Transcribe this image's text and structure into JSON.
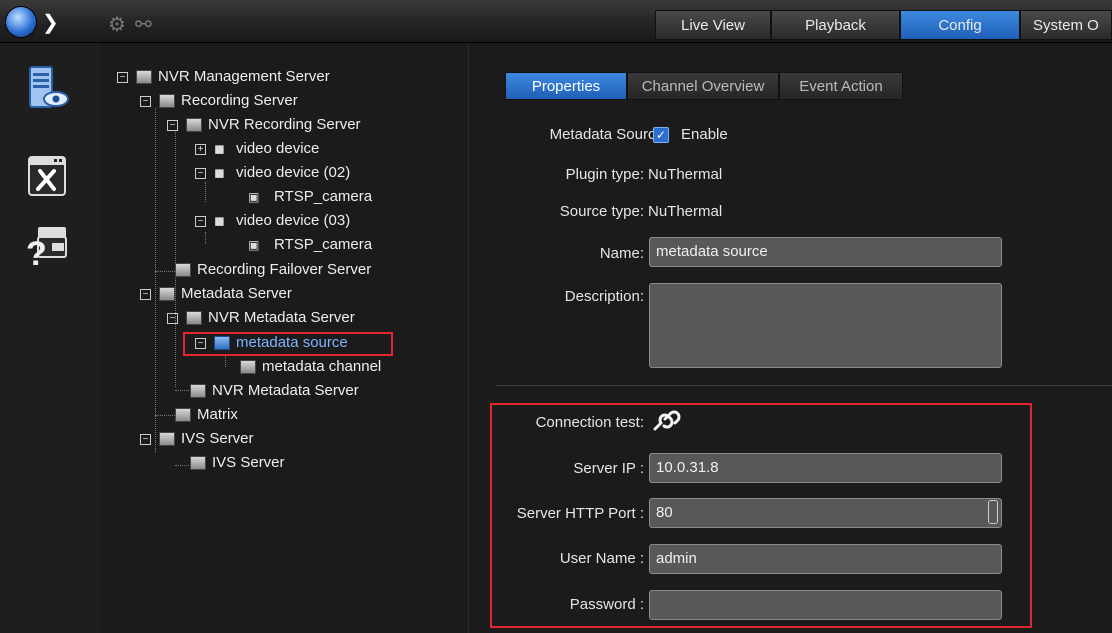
{
  "topbar": {
    "nav_tabs": [
      {
        "label": "Live View",
        "active": false
      },
      {
        "label": "Playback",
        "active": false
      },
      {
        "label": "Config",
        "active": true
      },
      {
        "label": "System O",
        "active": false
      }
    ]
  },
  "tree": {
    "items": [
      {
        "label": "NVR Management Server",
        "icon": "management-server-icon"
      },
      {
        "label": "Recording Server",
        "icon": "recording-server-icon"
      },
      {
        "label": "NVR Recording Server",
        "icon": "recording-server-icon"
      },
      {
        "label": "video device",
        "icon": "camera-icon"
      },
      {
        "label": "video device (02)",
        "icon": "camera-icon"
      },
      {
        "label": "RTSP_camera",
        "icon": "rtsp-camera-icon"
      },
      {
        "label": "video device (03)",
        "icon": "camera-icon"
      },
      {
        "label": "RTSP_camera",
        "icon": "rtsp-camera-icon"
      },
      {
        "label": "Recording Failover Server",
        "icon": "failover-server-icon"
      },
      {
        "label": "Metadata Server",
        "icon": "metadata-server-icon"
      },
      {
        "label": "NVR Metadata Server",
        "icon": "metadata-server-icon"
      },
      {
        "label": "metadata source",
        "icon": "metadata-source-icon",
        "selected": true
      },
      {
        "label": "metadata channel",
        "icon": "metadata-channel-icon"
      },
      {
        "label": "NVR Metadata Server",
        "icon": "metadata-server-offline-icon"
      },
      {
        "label": "Matrix",
        "icon": "matrix-icon"
      },
      {
        "label": "IVS Server",
        "icon": "ivs-server-icon"
      },
      {
        "label": "IVS Server",
        "icon": "ivs-server-icon"
      }
    ]
  },
  "main": {
    "tabs": [
      {
        "label": "Properties",
        "active": true
      },
      {
        "label": "Channel Overview",
        "active": false
      },
      {
        "label": "Event Action",
        "active": false
      }
    ],
    "metadata_source_label": "Metadata Source:",
    "enable_label": "Enable",
    "enable_checked": true,
    "plugin_type_label": "Plugin type:",
    "plugin_type_value": "NuThermal",
    "source_type_label": "Source type:",
    "source_type_value": "NuThermal",
    "name_label": "Name:",
    "name_value": "metadata source",
    "description_label": "Description:",
    "description_value": "",
    "connection_test_label": "Connection test:",
    "server_ip_label": "Server IP :",
    "server_ip_value": "10.0.31.8",
    "http_port_label": "Server HTTP Port :",
    "http_port_value": "80",
    "user_name_label": "User Name :",
    "user_name_value": "admin",
    "password_label": "Password :",
    "password_value": ""
  },
  "colors": {
    "accent": "#2f78d6",
    "highlight": "#e0262e",
    "background": "#1b1b1b"
  }
}
